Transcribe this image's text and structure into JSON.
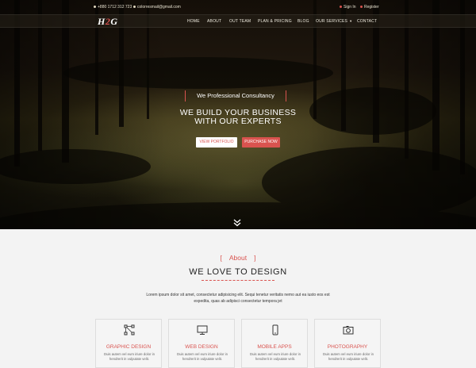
{
  "topbar": {
    "phone": "+880 1712 312 723",
    "email": "colorresmail@gmail.com",
    "signin": "Sign In",
    "register": "Register"
  },
  "brand": {
    "logo_part1": "H",
    "logo_part2": "2",
    "logo_part3": "G",
    "accent_color": "#d9534f"
  },
  "nav": {
    "home": "HOME",
    "about": "ABOUT",
    "team": "OUT TEAM",
    "plan": "PLAN & PRICING",
    "blog": "BLOG",
    "services": "OUR SERVICES",
    "contact": "CONTACT"
  },
  "hero": {
    "tagline": "We Professional Consultancy",
    "headline_line1": "WE BUILD YOUR BUSINESS",
    "headline_line2": "WITH OUR EXPERTS",
    "btn_portfolio": "VIEW PORTFOLIO",
    "btn_purchase": "PURCHASE NOW"
  },
  "about": {
    "bracket_open": "[",
    "label": "About",
    "bracket_close": "]",
    "title": "WE LOVE TO DESIGN",
    "desc_line1": "Lorem ipsum dolor sit amet, consectetur adipisicing elit. Sequi tenetur veritatis nemo aut ea iusto eos est",
    "desc_line2": "expedita, quas ab adipisci consectetur tempora jet"
  },
  "cards": [
    {
      "title": "GRAPHIC DESIGN",
      "icon": "graphic-design-icon",
      "text": "Duis autem vel eum iriure dolor in hendrerit in vulputate velit."
    },
    {
      "title": "WEB DESIGN",
      "icon": "monitor-icon",
      "text": "Duis autem vel eum iriure dolor in hendrerit in vulputate velit."
    },
    {
      "title": "MOBILE APPS",
      "icon": "mobile-icon",
      "text": "Duis autem vel eum iriure dolor in hendrerit in vulputate velit."
    },
    {
      "title": "PHOTOGRAPHY",
      "icon": "camera-icon",
      "text": "Duis autem vel eum iriure dolor in hendrerit in vulputate velit."
    }
  ]
}
